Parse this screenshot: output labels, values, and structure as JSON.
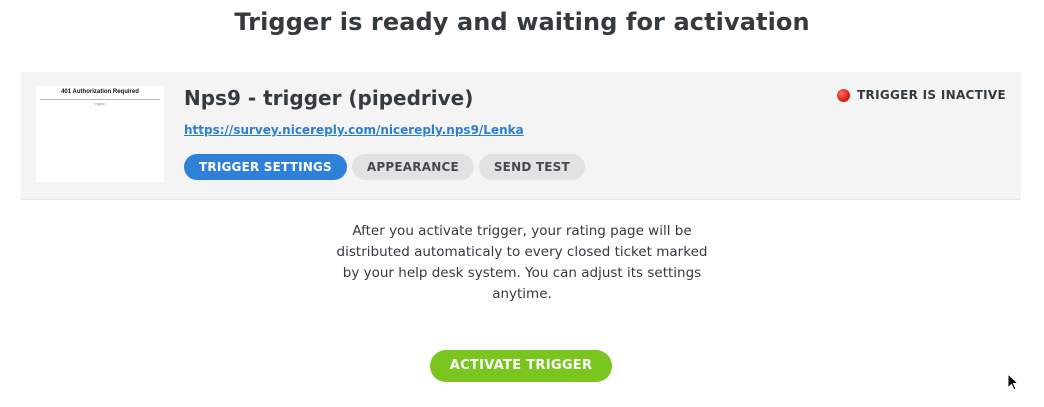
{
  "heading": "Trigger is ready and waiting for activation",
  "card": {
    "thumbnail": {
      "title": "401 Authorization Required",
      "subtitle": "nginx"
    },
    "title": "Nps9 - trigger (pipedrive)",
    "link": "https://survey.nicereply.com/nicereply.nps9/Lenka",
    "tabs": [
      {
        "label": "TRIGGER SETTINGS",
        "active": true
      },
      {
        "label": "APPEARANCE",
        "active": false
      },
      {
        "label": "SEND TEST",
        "active": false
      }
    ],
    "status": {
      "label": "TRIGGER IS INACTIVE",
      "icon": "red-status-dot-icon",
      "color": "#d1160c"
    }
  },
  "description": "After you activate trigger, your rating page will be distributed automaticaly to every closed ticket marked by your help desk system. You can adjust its settings anytime.",
  "activate_button": "ACTIVATE TRIGGER",
  "colors": {
    "accent_blue": "#2f80d8",
    "link_blue": "#2d7fd0",
    "activate_green": "#7ac51e",
    "card_bg": "#f4f4f4",
    "text": "#333a40"
  }
}
